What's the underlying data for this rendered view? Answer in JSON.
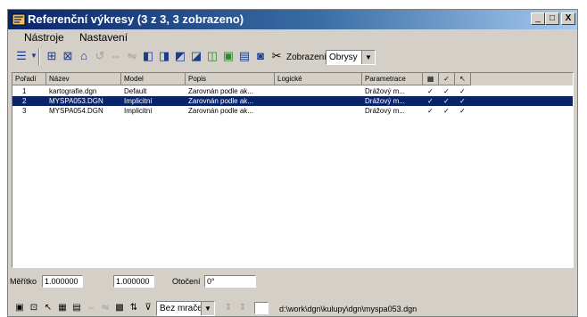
{
  "window": {
    "title": "Referenční výkresy (3 z 3, 3 zobrazeno)",
    "controls": {
      "minimize": "_",
      "maximize": "□",
      "close": "X"
    }
  },
  "menu": {
    "items": [
      "Nástroje",
      "Nastavení"
    ]
  },
  "toolbar": {
    "display_label": "Zobrazení:",
    "display_value": "Obrysy"
  },
  "table": {
    "columns": [
      "Pořadí",
      "Název",
      "Model",
      "Popis",
      "Logické",
      "Parametrace",
      "▦",
      "✓",
      "↖"
    ],
    "rows": [
      {
        "order": "1",
        "name": "kartografie.dgn",
        "model": "Default",
        "desc": "Zarovnán podle ak...",
        "logical": "",
        "params": "Drážový m...",
        "c1": "✓",
        "c2": "✓",
        "c3": "✓",
        "selected": false
      },
      {
        "order": "2",
        "name": "MYSPA053.DGN",
        "model": "Implicitní",
        "desc": "Zarovnán podle ak...",
        "logical": "",
        "params": "Drážový m...",
        "c1": "✓",
        "c2": "✓",
        "c3": "✓",
        "selected": true
      },
      {
        "order": "3",
        "name": "MYSPA054.DGN",
        "model": "Implicitní",
        "desc": "Zarovnán podle ak...",
        "logical": "",
        "params": "Drážový m...",
        "c1": "✓",
        "c2": "✓",
        "c3": "✓",
        "selected": false
      }
    ]
  },
  "status": {
    "scale_label": "Měřítko",
    "scale_value1": "1.000000",
    "scale_value2": "1.000000",
    "rotation_label": "Otočení",
    "rotation_value": "0°",
    "mode_value": "Bez mračení",
    "path": "d:\\work\\dgn\\kulupy\\dgn\\myspa053.dgn"
  }
}
